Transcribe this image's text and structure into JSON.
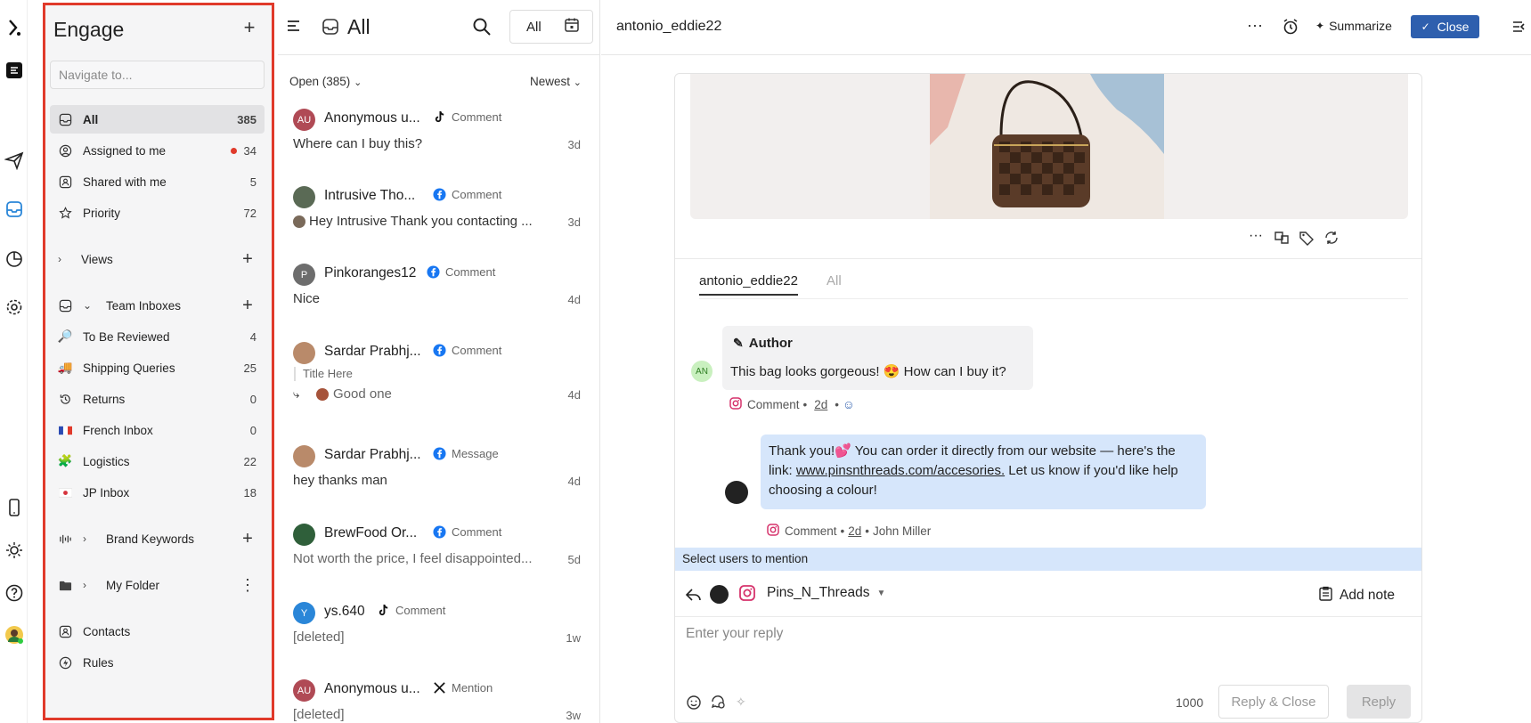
{
  "nav": {
    "title": "Engage",
    "search_placeholder": "Navigate to...",
    "items": [
      {
        "label": "All",
        "count": "385",
        "icon": "inbox-icon"
      },
      {
        "label": "Assigned to me",
        "count": "34",
        "icon": "user-circle-icon"
      },
      {
        "label": "Shared with me",
        "count": "5",
        "icon": "shared-icon"
      },
      {
        "label": "Priority",
        "count": "72",
        "icon": "star-icon"
      }
    ],
    "views_label": "Views",
    "team_inboxes_label": "Team Inboxes",
    "team_inboxes": [
      {
        "label": "To Be Reviewed",
        "count": "4",
        "icon": "magnifier-emoji-icon"
      },
      {
        "label": "Shipping Queries",
        "count": "25",
        "icon": "truck-emoji-icon"
      },
      {
        "label": "Returns",
        "count": "0",
        "icon": "history-icon"
      },
      {
        "label": "French Inbox",
        "count": "0",
        "icon": "france-flag-icon"
      },
      {
        "label": "Logistics",
        "count": "22",
        "icon": "puzzle-emoji-icon"
      },
      {
        "label": "JP Inbox",
        "count": "18",
        "icon": "japan-flag-icon"
      }
    ],
    "brand_keywords_label": "Brand Keywords",
    "my_folder_label": "My Folder",
    "contacts_label": "Contacts",
    "rules_label": "Rules"
  },
  "list": {
    "title": "All",
    "filter_label": "All",
    "open_label": "Open (385)",
    "sort_label": "Newest",
    "conversations": [
      {
        "name": "Anonymous u...",
        "initials": "AU",
        "avatar_color": "#b04a55",
        "source": "Comment",
        "source_icon": "tiktok-icon",
        "message": "Where can I buy this?",
        "time": "3d"
      },
      {
        "name": "Intrusive Tho...",
        "initials": "",
        "avatar_color": "#5a6a55",
        "source": "Comment",
        "source_icon": "facebook-icon",
        "message": "Hey Intrusive Thank you contacting ...",
        "time": "3d"
      },
      {
        "name": "Pinkoranges12",
        "initials": "P",
        "avatar_color": "#6d6d6d",
        "source": "Comment",
        "source_icon": "facebook-icon",
        "message": "Nice",
        "time": "4d"
      },
      {
        "name": "Sardar Prabhj...",
        "initials": "",
        "avatar_color": "#b98a6a",
        "source": "Comment",
        "source_icon": "facebook-icon",
        "sub": "Title Here",
        "message": "Good one",
        "time": "4d"
      },
      {
        "name": "Sardar Prabhj...",
        "initials": "",
        "avatar_color": "#b98a6a",
        "source": "Message",
        "source_icon": "facebook-icon",
        "message": "hey thanks man",
        "time": "4d"
      },
      {
        "name": "BrewFood Or...",
        "initials": "",
        "avatar_color": "#2f5f3a",
        "source": "Comment",
        "source_icon": "facebook-icon",
        "message": "Not worth the price, I feel disappointed...",
        "time": "5d"
      },
      {
        "name": "ys.640",
        "initials": "Y",
        "avatar_color": "#2a86d8",
        "source": "Comment",
        "source_icon": "tiktok-icon",
        "message": "[deleted]",
        "time": "1w"
      },
      {
        "name": "Anonymous u...",
        "initials": "AU",
        "avatar_color": "#b04a55",
        "source": "Mention",
        "source_icon": "x-icon",
        "message": "[deleted]",
        "time": "3w"
      }
    ]
  },
  "detail": {
    "username": "antonio_eddie22",
    "summarize_label": "Summarize",
    "close_label": "Close",
    "tab_user": "antonio_eddie22",
    "tab_all": "All",
    "author_label": "Author",
    "author_initials": "AN",
    "author_message": "This bag looks gorgeous! 😍 How can I buy it?",
    "author_meta_type": "Comment",
    "author_meta_time": "2d",
    "reply_message_pre": "Thank you!💕 You can order it directly from our website — here's the link: ",
    "reply_link": "www.pinsnthreads.com/accesories.",
    "reply_message_post": " Let us know if you'd like help choosing a colour!",
    "reply_meta_type": "Comment",
    "reply_meta_time": "2d",
    "reply_meta_agent": "John Miller",
    "mention_bar": "Select users to mention",
    "account_name": "Pins_N_Threads",
    "add_note_label": "Add note",
    "reply_placeholder": "Enter your reply",
    "char_count": "1000",
    "reply_close_label": "Reply & Close",
    "reply_label": "Reply"
  },
  "colors": {
    "accent": "#2e5fae",
    "highlight_border": "#e03a2b",
    "mention_bg": "#d6e6fb",
    "instagram": "#d6336c",
    "facebook": "#1877f2"
  }
}
